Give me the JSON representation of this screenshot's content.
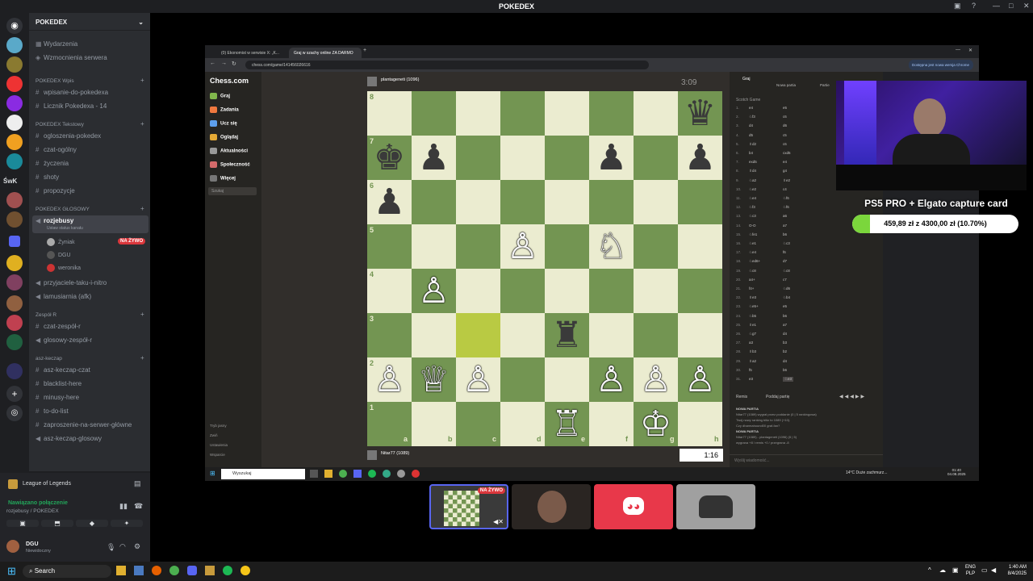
{
  "window": {
    "title": "POKEDEX"
  },
  "discord": {
    "server_name": "POKEDEX",
    "top_items": [
      "Wydarzenia",
      "Wzmocnienia serwera"
    ],
    "categories": [
      {
        "name": "POKEDEX Wpis",
        "channels": [
          "wpisanie-do-pokedexa",
          "Licznik Pokedexa - 14"
        ]
      },
      {
        "name": "POKEDEX Tekstowy",
        "channels": [
          "ogloszenia-pokedex",
          "czat-ogólny",
          "życzenia",
          "shoty",
          "propozycje"
        ]
      },
      {
        "name": "POKEDEX GŁOSOWY",
        "channels": [
          "rozjebusy"
        ]
      },
      {
        "name": "Zespół R",
        "channels": [
          "czat-zespół-r",
          "glosowy-zespół-r"
        ]
      },
      {
        "name": "asz-keczap",
        "channels": [
          "asz-keczap-czat",
          "blacklist-here",
          "minusy-here",
          "to-do-list",
          "zaproszenie-na-serwer-główne",
          "asz-keczap-glosowy"
        ]
      }
    ],
    "voice_status": "Ustaw status kanału",
    "voice_users": [
      "Żyniak",
      "DGU",
      "weronika"
    ],
    "live_badge": "NA ŻYWO",
    "extra_channels": [
      "przyjaciele-taku-i-nitro",
      "lamusiarnia (afk)"
    ],
    "activity": "League of Legends",
    "connection": "Nawiązano połączenie",
    "connection_sub": "rozjebusy / POKEDEX",
    "user_name": "DGU",
    "user_status": "Niewidoczny",
    "server_label": "ŚwK"
  },
  "browser": {
    "tabs": [
      "(0) Ekonomist w serwisie X: „K...",
      "Graj w szachy online ZA DARMO"
    ],
    "url": "chess.com/game/141456026616",
    "update_notice": "Dostępna jest nowa wersja Chrome"
  },
  "chess": {
    "logo": "Chess.com",
    "nav": [
      "Graj",
      "Zadania",
      "Ucz się",
      "Oglądaj",
      "Aktualności",
      "Społeczność",
      "Więcej"
    ],
    "search_placeholder": "Szukaj",
    "bottom_nav": [
      "Tryb jasny",
      "Zwiń",
      "Ustawienia",
      "Wsparcie"
    ],
    "top_player": "plantageneti (1096)",
    "bottom_player": "Nitar77 (1089)",
    "top_clock": "3:09",
    "bottom_clock": "1:16",
    "panel_tabs": [
      "Graj",
      "Nowa partia",
      "Partie"
    ],
    "opening": "Scotch Game",
    "moves": [
      [
        "e4",
        "e5"
      ],
      [
        "♘f3",
        "c6"
      ],
      [
        "d4",
        "d6"
      ],
      [
        "d5",
        "c5"
      ],
      [
        "♗d2",
        "c6"
      ],
      [
        "b4",
        "cxd5"
      ],
      [
        "exd5",
        "e4"
      ],
      [
        "♗d4",
        "g4"
      ],
      [
        "♘a2",
        "♗e2"
      ],
      [
        "♘e2",
        "c4"
      ],
      [
        "♘e4",
        "♘f6"
      ],
      [
        "♘f3",
        "♘f6"
      ],
      [
        "♘c3",
        "a6"
      ],
      [
        "O-O",
        "a7"
      ],
      [
        "♘fe1",
        "b6"
      ],
      [
        "♘e1",
        "♘c3"
      ],
      [
        "♘e4",
        "f6"
      ],
      [
        "♘ed6+",
        "d7"
      ],
      [
        "♘c8",
        "♘c8"
      ],
      [
        "a4+",
        "c7"
      ],
      [
        "f4+",
        "♘d6"
      ],
      [
        "♗e3",
        "♘b4"
      ],
      [
        "♘e5+",
        "e5"
      ],
      [
        "♘b5",
        "b6"
      ],
      [
        "♗e1",
        "a7"
      ],
      [
        "♘g7",
        "d4"
      ],
      [
        "a3",
        "b3"
      ],
      [
        "♗b3",
        "b2"
      ],
      [
        "♗a2",
        "d4"
      ],
      [
        "f5",
        "b6"
      ],
      [
        "e3",
        "♘e3"
      ]
    ],
    "actions": [
      "Remis",
      "Poddaj partię"
    ],
    "chat_header": "NOWA PARTIA",
    "chat_lines": [
      "Nitar77 (1089) wygrał przez poddanie (0 | 5 rankingowa)",
      "Twój nowy ranking blitz to 1089 (+10).",
      "Czy dharmahound00 graf-fan?",
      "NOWA PARTIA",
      "Nitar77 (1089) - plantageneti (1096) (5 | 5)",
      "wygrana +8 / remis +0 / przegrana -8"
    ],
    "chat_placeholder": "Wyślij wiadomość..."
  },
  "taskbar_inner": {
    "search": "Wyszukaj",
    "weather": "14°C Duże zachmurz...",
    "time": "01:40",
    "date": "04.08.2025"
  },
  "overlay": {
    "goal_title": "PS5 PRO + Elgato capture card",
    "goal_text": "459,89 zł z 4300,00 zł (10.70%)",
    "goal_fraction": 0.107,
    "live_badge": "NA ŻYWO"
  },
  "win_taskbar": {
    "search": "Search",
    "lang": "ENG",
    "lang2": "PLP",
    "time": "1:40 AM",
    "date": "8/4/2025"
  },
  "colors": {
    "discord_bg": "#2b2d31",
    "board_light": "#ebecd0",
    "board_dark": "#739552",
    "live": "#da373c",
    "discord_blurple": "#5865f2"
  }
}
